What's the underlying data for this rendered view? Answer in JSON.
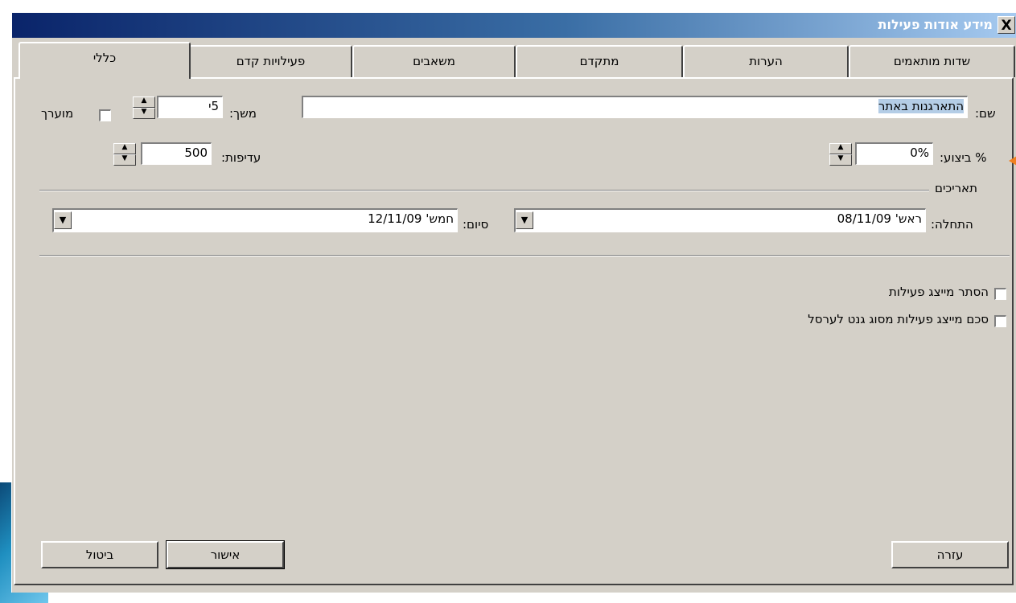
{
  "window": {
    "title": "מידע אודות פעילות",
    "close_glyph": "X"
  },
  "tabs": [
    {
      "label": "שדות מותאמים",
      "active": false
    },
    {
      "label": "הערות",
      "active": false
    },
    {
      "label": "מתקדם",
      "active": false
    },
    {
      "label": "משאבים",
      "active": false
    },
    {
      "label": "פעילויות קדם",
      "active": false
    },
    {
      "label": "כללי",
      "active": true
    }
  ],
  "general": {
    "name_label": "שם:",
    "name_value": "התארגנות באתר",
    "duration_label": "משך:",
    "duration_value": "5י",
    "estimated_label": "מוערך",
    "percent_label": "% ביצוע:",
    "percent_value": "0%",
    "priority_label": "עדיפות:",
    "priority_value": "500",
    "dates_group": "תאריכים",
    "start_label": "התחלה:",
    "start_value": "ראש' 08/11/09",
    "finish_label": "סיום:",
    "finish_value": "חמש' 12/11/09",
    "hide_bar_label": "הסתר מייצג פעילות",
    "rollup_label": "סכם מייצג פעילות מסוג גנט לערסל"
  },
  "buttons": {
    "help": "עזרה",
    "ok": "אישור",
    "cancel": "ביטול"
  },
  "colors": {
    "title_start": "#0a246a",
    "title_end": "#a6caf0",
    "face": "#d4d0c8",
    "selection": "#b4cde6"
  }
}
